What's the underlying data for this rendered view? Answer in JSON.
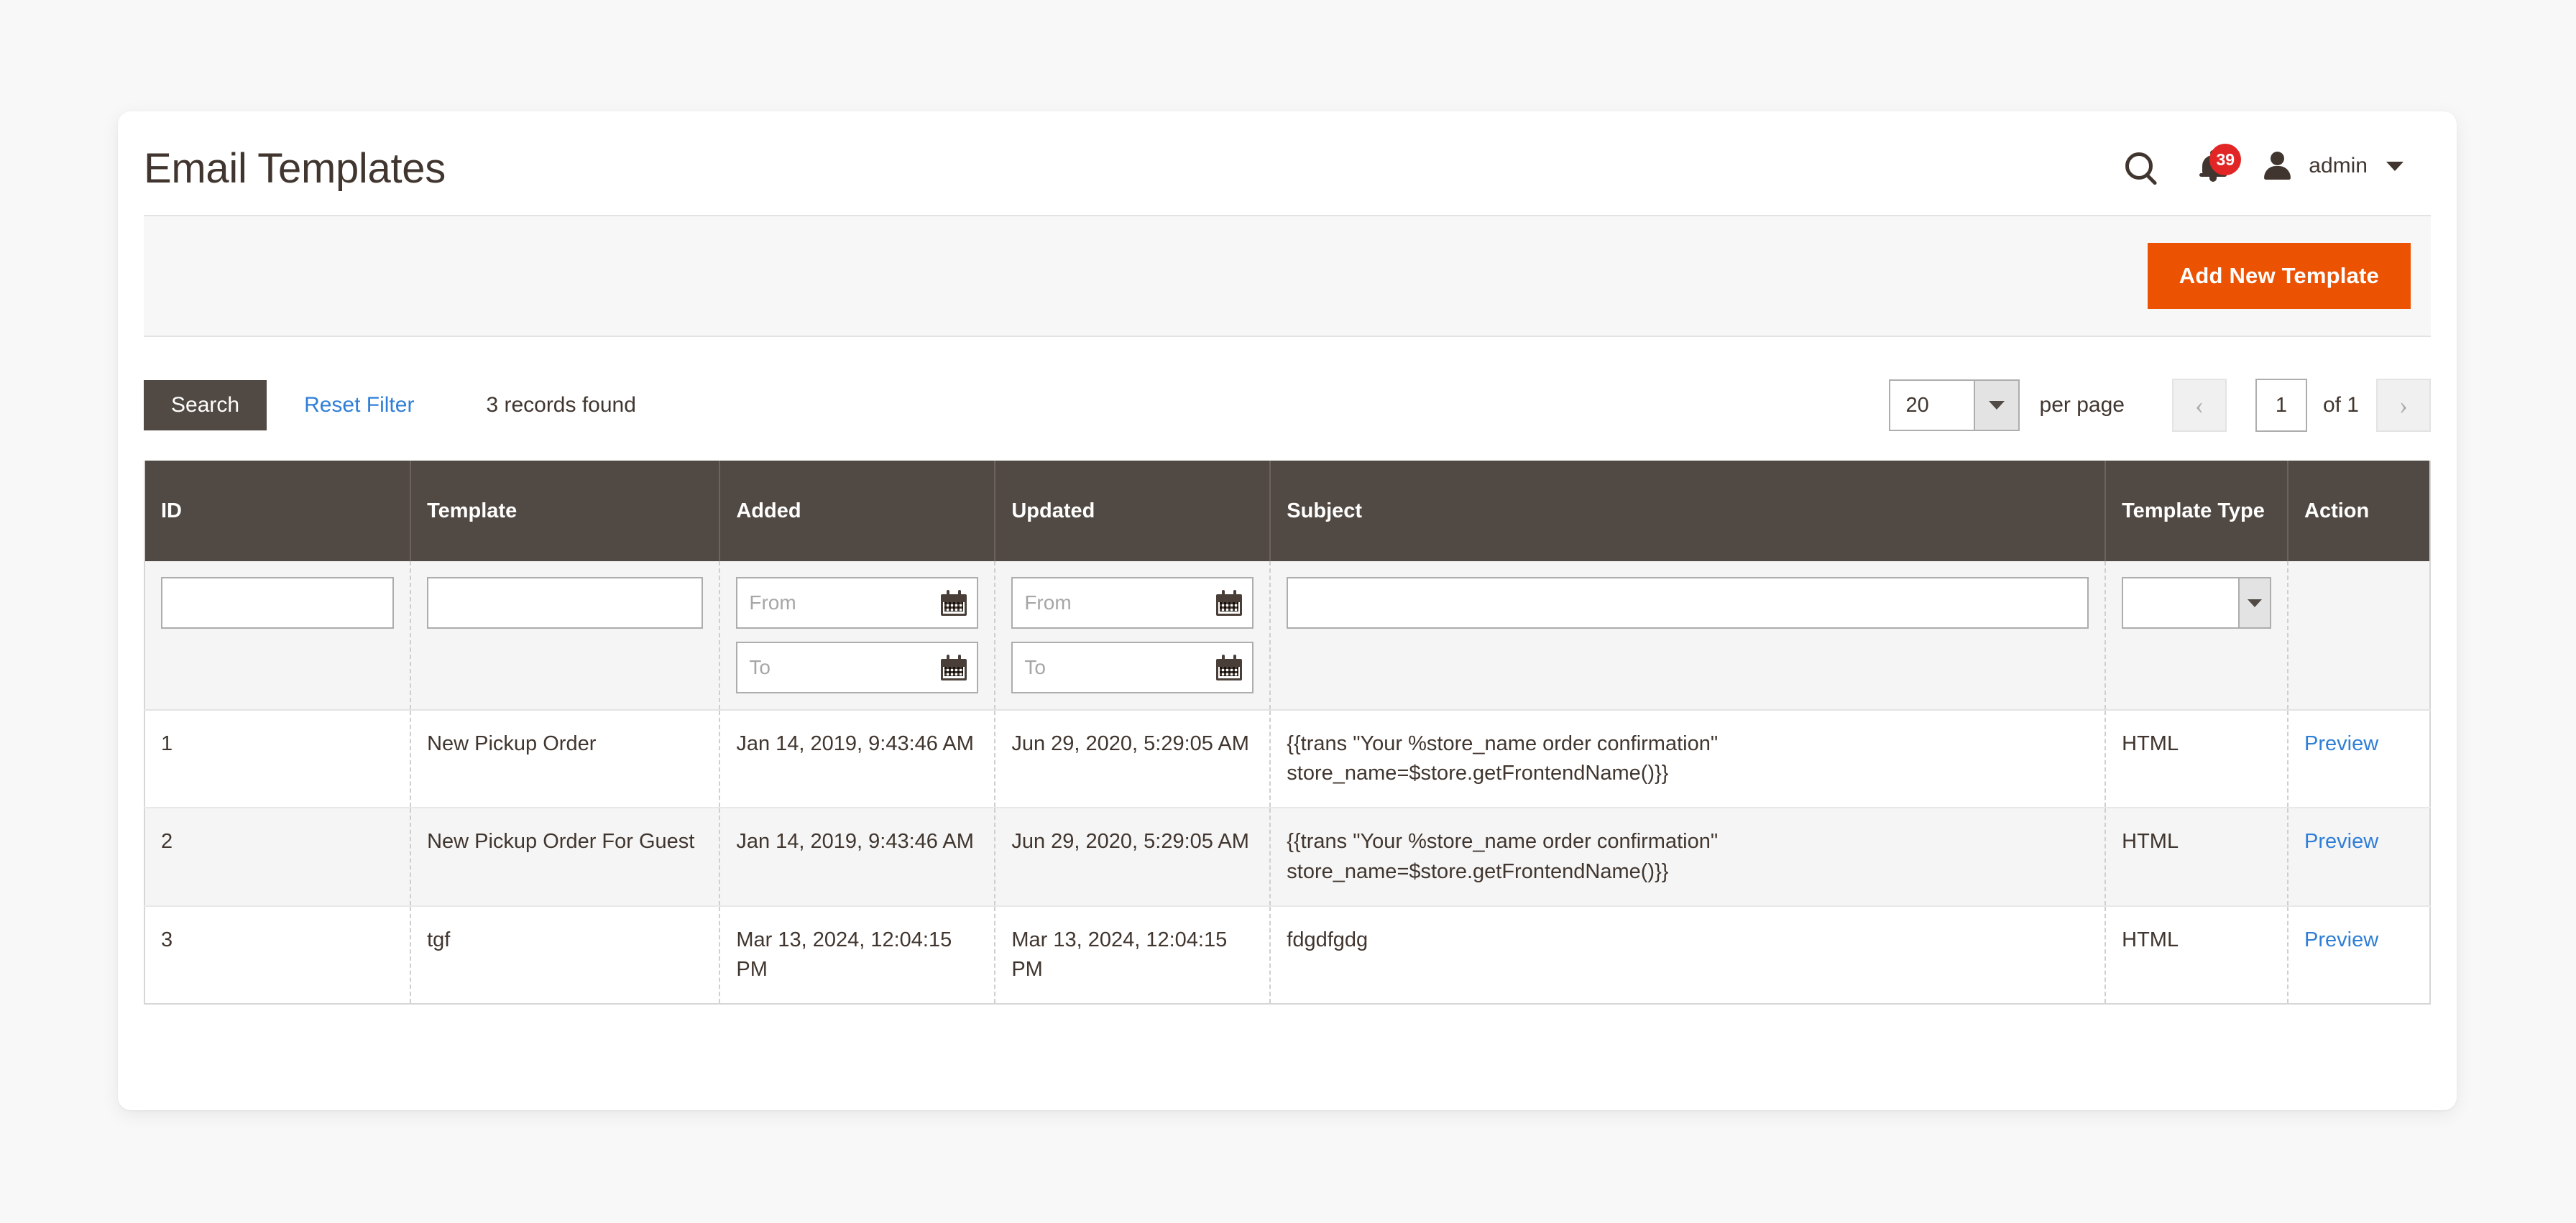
{
  "header": {
    "title": "Email Templates",
    "search_icon": "search-icon",
    "notifications": {
      "icon": "bell-icon",
      "count": "39"
    },
    "user": {
      "avatar_icon": "user-avatar-icon",
      "name": "admin",
      "caret_icon": "chevron-down-icon"
    }
  },
  "page_actions": {
    "add_new_template": "Add New Template",
    "accent_color": "#eb5202"
  },
  "toolbar": {
    "search_label": "Search",
    "reset_filter_label": "Reset Filter",
    "records_found": "3 records found",
    "per_page_value": "20",
    "per_page_label": "per page",
    "prev_page_icon": "chevron-left-icon",
    "next_page_icon": "chevron-right-icon",
    "current_page": "1",
    "total_pages_label": "of 1"
  },
  "grid": {
    "columns": [
      {
        "key": "id",
        "label": "ID"
      },
      {
        "key": "template",
        "label": "Template"
      },
      {
        "key": "added",
        "label": "Added"
      },
      {
        "key": "updated",
        "label": "Updated"
      },
      {
        "key": "subject",
        "label": "Subject"
      },
      {
        "key": "type",
        "label": "Template Type"
      },
      {
        "key": "action",
        "label": "Action"
      }
    ],
    "filters": {
      "id": "",
      "template": "",
      "added_from_placeholder": "From",
      "added_to_placeholder": "To",
      "updated_from_placeholder": "From",
      "updated_to_placeholder": "To",
      "subject": "",
      "type": "",
      "calendar_icon": "calendar-icon"
    },
    "rows": [
      {
        "id": "1",
        "template": "New Pickup Order",
        "added": "Jan 14, 2019, 9:43:46 AM",
        "updated": "Jun 29, 2020, 5:29:05 AM",
        "subject": "{{trans \"Your %store_name order confirmation\" store_name=$store.getFrontendName()}}",
        "type": "HTML",
        "action": "Preview"
      },
      {
        "id": "2",
        "template": "New Pickup Order For Guest",
        "added": "Jan 14, 2019, 9:43:46 AM",
        "updated": "Jun 29, 2020, 5:29:05 AM",
        "subject": "{{trans \"Your %store_name order confirmation\" store_name=$store.getFrontendName()}}",
        "type": "HTML",
        "action": "Preview"
      },
      {
        "id": "3",
        "template": "tgf",
        "added": "Mar 13, 2024, 12:04:15 PM",
        "updated": "Mar 13, 2024, 12:04:15 PM",
        "subject": "fdgdfgdg",
        "type": "HTML",
        "action": "Preview"
      }
    ]
  }
}
